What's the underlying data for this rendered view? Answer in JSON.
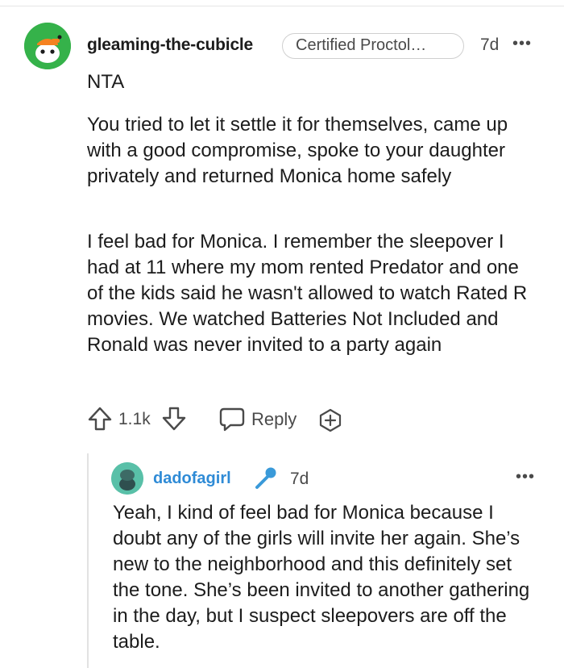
{
  "comment": {
    "username": "gleaming-the-cubicle",
    "flair": "Certified Proctol…",
    "age": "7d",
    "more": "•••",
    "paragraphs": [
      "NTA",
      "You tried to let it settle it for themselves, came up with a good compromise, spoke to your daughter privately and returned Monica home safely",
      "I feel bad for Monica. I remember the sleepover I had at 11 where my mom rented Predator and one of the kids said he wasn't allowed to watch Rated R movies. We watched Batteries Not Included and Ronald was never invited to a party again"
    ],
    "score": "1.1k",
    "reply_label": "Reply"
  },
  "reply": {
    "username": "dadofagirl",
    "age": "7d",
    "more": "•••",
    "username_color": "#2f8bd6",
    "text": "Yeah, I kind of feel bad for Monica because I doubt any of the girls will invite her again. She’s new to the neighborhood and this definitely set the tone. She’s been invited to another gathering in the day, but I suspect sleepovers are off the table."
  },
  "icons": {
    "upvote": "arrow-up-icon",
    "downvote": "arrow-down-icon",
    "reply": "speech-bubble-icon",
    "award": "award-plus-icon",
    "flair_user_icon": "microphone-icon"
  }
}
